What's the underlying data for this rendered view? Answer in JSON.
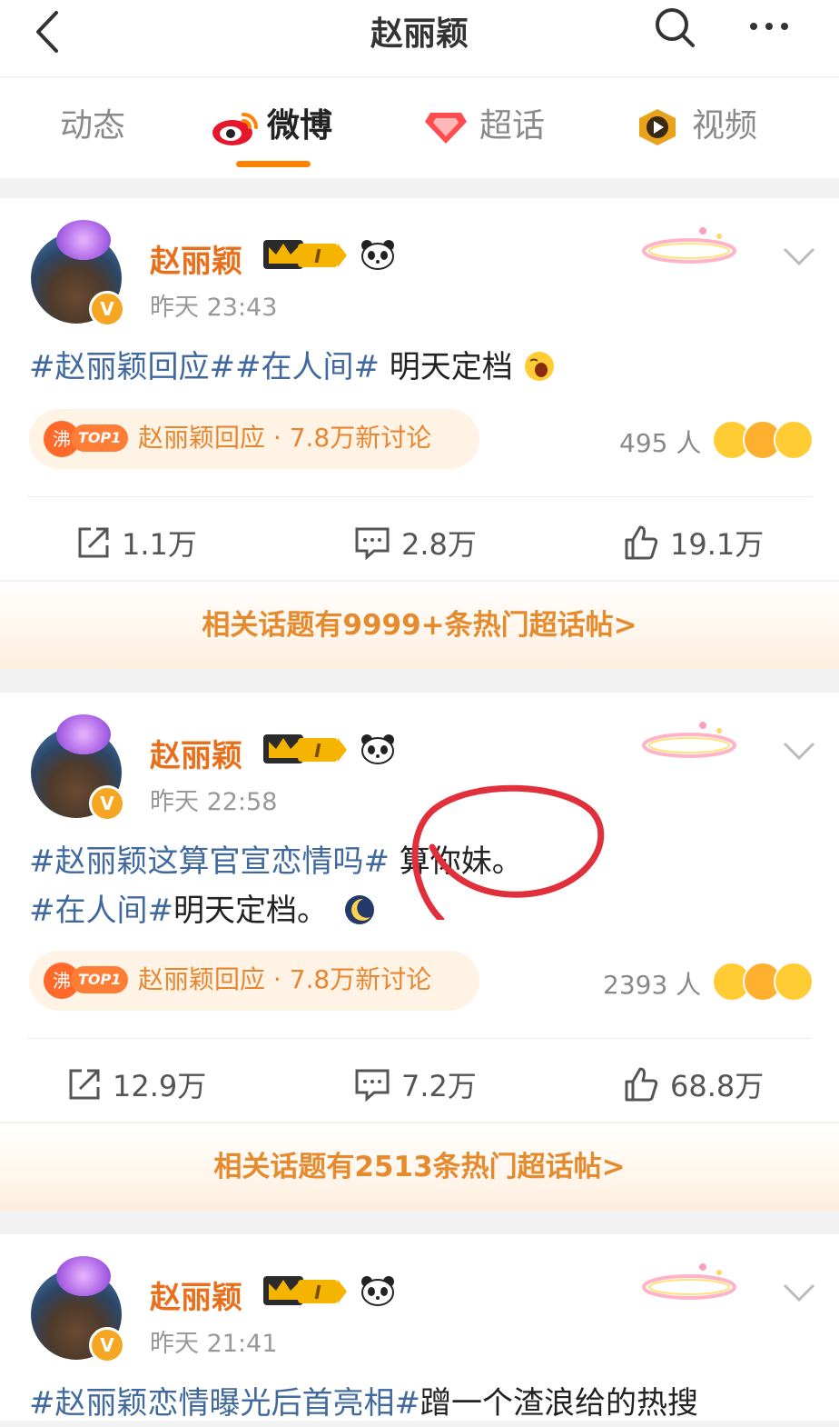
{
  "header": {
    "title": "赵丽颖"
  },
  "tabs": [
    {
      "label": "动态"
    },
    {
      "label": "微博"
    },
    {
      "label": "超话"
    },
    {
      "label": "视频"
    }
  ],
  "posts": [
    {
      "username": "赵丽颖",
      "level": "I",
      "time": "昨天 23:43",
      "text_topics": "#赵丽颖回应##在人间#",
      "text_body": " 明天定档",
      "text_line2_topic": "",
      "text_line2_body": "",
      "hot_label": "沸",
      "hot_rank": "TOP1",
      "hot_topic": "赵丽颖回应 · 7.8万新讨论",
      "people": "495 人",
      "share": "1.1万",
      "comment": "2.8万",
      "like": "19.1万",
      "banner": "相关话题有9999+条热门超话帖>"
    },
    {
      "username": "赵丽颖",
      "level": "I",
      "time": "昨天 22:58",
      "text_topics": "#赵丽颖这算官宣恋情吗#",
      "text_body": " 算你妹。",
      "text_line2_topic": "#在人间#",
      "text_line2_body": "明天定档。",
      "hot_label": "沸",
      "hot_rank": "TOP1",
      "hot_topic": "赵丽颖回应 · 7.8万新讨论",
      "people": "2393 人",
      "share": "12.9万",
      "comment": "7.2万",
      "like": "68.8万",
      "banner": "相关话题有2513条热门超话帖>"
    },
    {
      "username": "赵丽颖",
      "level": "I",
      "time": "昨天 21:41",
      "text_topics": "#赵丽颖恋情曝光后首亮相#",
      "text_body": "蹭一个渣浪给的热搜"
    }
  ],
  "icons": {
    "back": "back-arrow-icon",
    "search": "search-icon",
    "more": "more-icon",
    "share": "share-icon",
    "comment": "comment-icon",
    "like": "like-icon"
  },
  "colors": {
    "accent": "#ff8200",
    "username": "#e86f1c",
    "topic": "#40699d",
    "banner_text": "#e58a2d"
  }
}
